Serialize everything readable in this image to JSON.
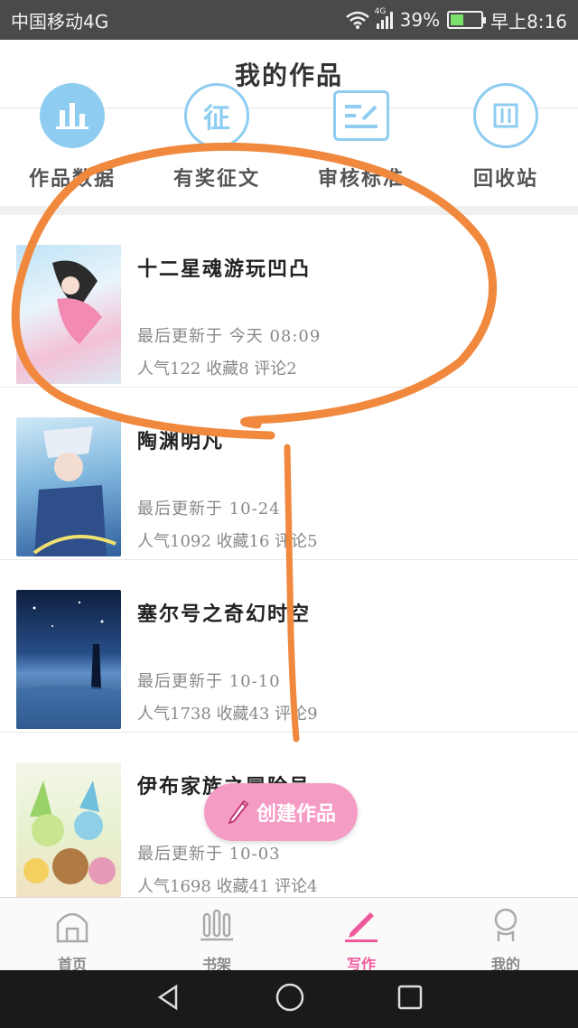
{
  "status_bar": {
    "carrier": "中国移动4G",
    "network_tag": "4G",
    "battery": "39%",
    "time": "早上8:16"
  },
  "header": {
    "title": "我的作品"
  },
  "quick_actions": [
    {
      "label": "作品数据",
      "icon": "chart-icon"
    },
    {
      "label": "有奖征文",
      "icon": "contest-icon"
    },
    {
      "label": "审核标准",
      "icon": "review-icon"
    },
    {
      "label": "回收站",
      "icon": "recycle-bin-icon"
    }
  ],
  "works": [
    {
      "title": "十二星魂游玩凹凸",
      "updated": "最后更新于 今天 08:09",
      "stats": "人气122 收藏8 评论2"
    },
    {
      "title": "陶渊明凡",
      "updated": "最后更新于 10-24",
      "stats": "人气1092 收藏16 评论5"
    },
    {
      "title": "塞尔号之奇幻时空",
      "updated": "最后更新于 10-10",
      "stats": "人气1738 收藏43 评论9"
    },
    {
      "title": "伊布家族之冒险号",
      "updated": "最后更新于 10-03",
      "stats": "人气1698 收藏41 评论4"
    }
  ],
  "fab": {
    "label": "创建作品"
  },
  "tabs": [
    {
      "label": "首页",
      "active": false
    },
    {
      "label": "书架",
      "active": false
    },
    {
      "label": "写作",
      "active": true
    },
    {
      "label": "我的",
      "active": false
    }
  ],
  "colors": {
    "accent": "#f05a9c",
    "icon_blue": "#8ecdf1",
    "fab": "#f59cc5",
    "annotation": "#f0883e"
  }
}
